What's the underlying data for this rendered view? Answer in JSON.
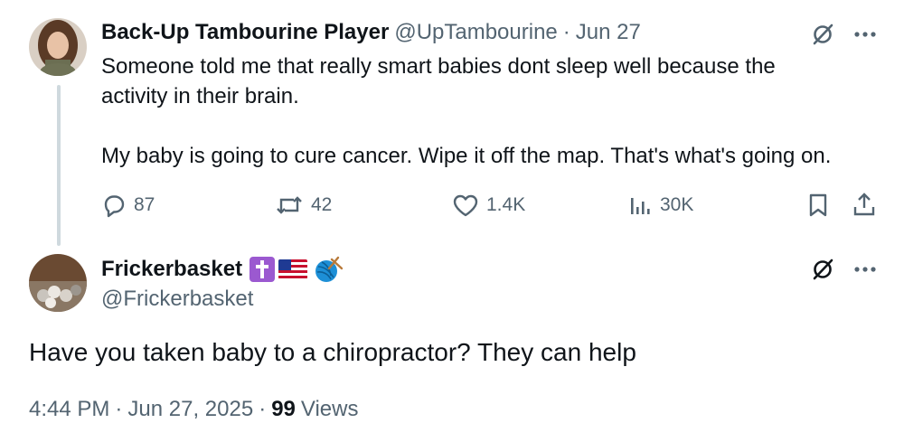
{
  "tweet1": {
    "display_name": "Back-Up Tambourine Player",
    "handle": "@UpTambourine",
    "separator": "·",
    "date": "Jun 27",
    "text_line1": "Someone told me that really smart babies dont sleep well because the",
    "text_line2": "activity in their brain.",
    "text_line3": "My baby is going to cure cancer. Wipe it off the map. That's what's going on.",
    "replies": "87",
    "reposts": "42",
    "likes": "1.4K",
    "views": "30K"
  },
  "tweet2": {
    "display_name": "Frickerbasket",
    "handle": "@Frickerbasket",
    "badges": [
      "latin-cross-emoji",
      "us-flag-emoji",
      "yarn-emoji"
    ],
    "text": "Have you taken baby to a chiropractor? They can help",
    "time": "4:44 PM",
    "separator1": "·",
    "date": "Jun 27, 2025",
    "separator2": "·",
    "views_count": "99",
    "views_label": "Views"
  },
  "colors": {
    "text_primary": "#0f1419",
    "text_secondary": "#536471",
    "thread_line": "#cfd9de",
    "cross_badge": "#9b59d0"
  },
  "icons": [
    "reply-icon",
    "repost-icon",
    "like-icon",
    "views-icon",
    "bookmark-icon",
    "share-icon",
    "grok-icon",
    "more-icon"
  ]
}
